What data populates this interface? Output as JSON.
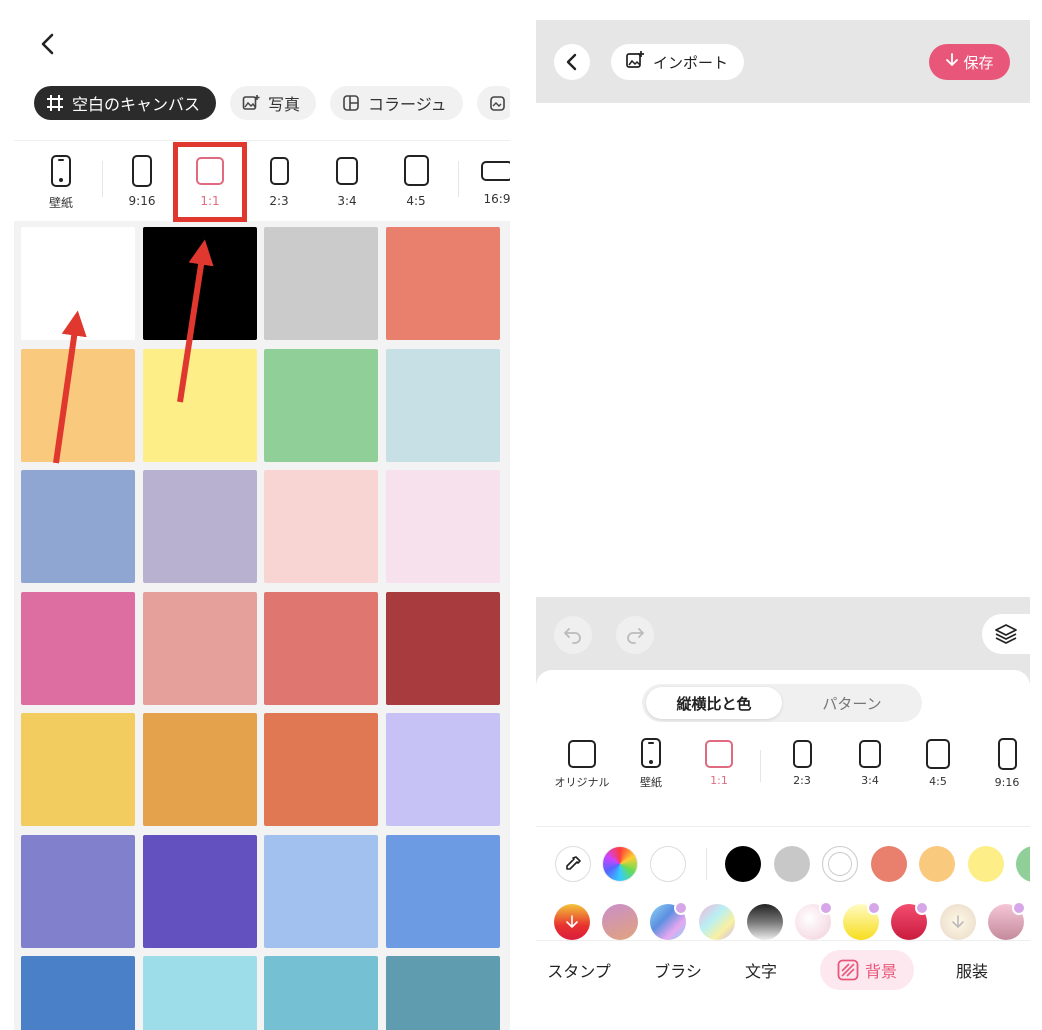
{
  "left": {
    "tabs": [
      {
        "label": "空白のキャンバス",
        "icon": "grid-icon",
        "active": true
      },
      {
        "label": "写真",
        "icon": "image-plus-icon",
        "active": false
      },
      {
        "label": "コラージュ",
        "icon": "collage-icon",
        "active": false
      }
    ],
    "ratios": [
      {
        "label": "壁紙"
      },
      {
        "label": "9:16"
      },
      {
        "label": "1:1",
        "selected": true
      },
      {
        "label": "2:3"
      },
      {
        "label": "3:4"
      },
      {
        "label": "4:5"
      },
      {
        "label": "16:9"
      }
    ],
    "swatches": [
      "#ffffff",
      "#000000",
      "#cbcbcb",
      "#e8806d",
      "#f9c97e",
      "#fdee88",
      "#90cf98",
      "#c6e0e6",
      "#8fa6d3",
      "#b8b2d0",
      "#f8d5d3",
      "#f6e1ec",
      "#dd6ea2",
      "#e6a09b",
      "#e07670",
      "#a83b3d",
      "#f2cc5e",
      "#e5a24c",
      "#e07953",
      "#c6c2f5",
      "#8180cd",
      "#6251bf",
      "#a2c1ef",
      "#6c9be4",
      "#4a80c7",
      "#9cdde9",
      "#75c0d3",
      "#5f9cb0"
    ],
    "annotation_color": "#e0372e"
  },
  "right": {
    "import_label": "インポート",
    "save_label": "保存",
    "accent": "#e8577a",
    "segment": {
      "active": "縦横比と色",
      "inactive": "パターン"
    },
    "ratios": [
      {
        "label": "オリジナル"
      },
      {
        "label": "壁紙"
      },
      {
        "label": "1:1",
        "selected": true
      },
      {
        "label": "2:3"
      },
      {
        "label": "3:4"
      },
      {
        "label": "4:5"
      },
      {
        "label": "9:16"
      }
    ],
    "solid_colors": [
      "#000000",
      "#c8c8c8",
      "#ffffff",
      "#e8806d",
      "#f9c97e",
      "#fdee88",
      "#90cf98"
    ],
    "gradient_badges": [
      false,
      false,
      true,
      false,
      false,
      true,
      true,
      true,
      false,
      true
    ],
    "nav": [
      "スタンプ",
      "ブラシ",
      "文字",
      "背景",
      "服装"
    ],
    "nav_active": "背景"
  }
}
